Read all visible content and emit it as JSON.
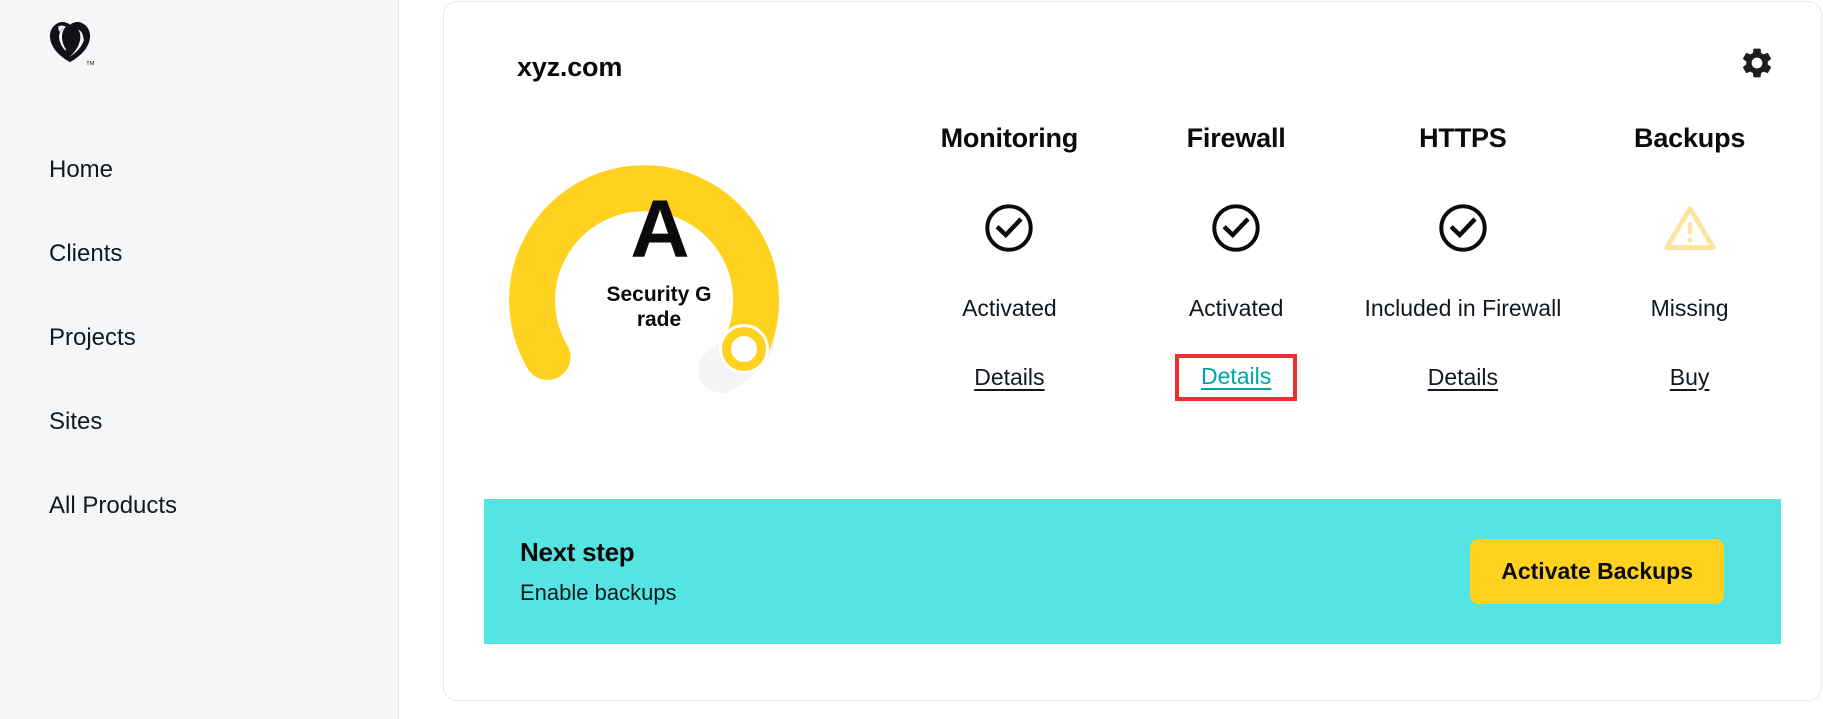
{
  "sidebar": {
    "logo": {
      "name": "godaddy-logo",
      "trademark": "TM"
    },
    "items": [
      {
        "label": "Home"
      },
      {
        "label": "Clients"
      },
      {
        "label": "Projects"
      },
      {
        "label": "Sites"
      },
      {
        "label": "All Products"
      }
    ]
  },
  "card": {
    "site_title": "xyz.com",
    "settings_icon": "gear-icon",
    "gauge": {
      "grade": "A",
      "label": "Security Grade",
      "label_rendered_line1": "Securit",
      "label_rendered_line2": "y Grade",
      "arc_color": "#ffd21f",
      "track_color": "#f2f4f6",
      "marker_color": "#ffd21f",
      "fill_fraction": 0.85
    },
    "columns": [
      {
        "title": "Monitoring",
        "icon": "check-circle-icon",
        "icon_color": "#0b0b0b",
        "status": "Activated",
        "link": "Details",
        "highlighted": false
      },
      {
        "title": "Firewall",
        "icon": "check-circle-icon",
        "icon_color": "#0b0b0b",
        "status": "Activated",
        "link": "Details",
        "highlighted": true,
        "highlight_color": "#ee2e32",
        "link_color": "#01a4a4"
      },
      {
        "title": "HTTPS",
        "icon": "check-circle-icon",
        "icon_color": "#0b0b0b",
        "status": "Included in Firewall",
        "link": "Details",
        "highlighted": false
      },
      {
        "title": "Backups",
        "icon": "warning-triangle-icon",
        "icon_color": "#fbe4a0",
        "status": "Missing",
        "link": "Buy",
        "highlighted": false
      }
    ],
    "banner": {
      "title": "Next step",
      "subtitle": "Enable backups",
      "button_label": "Activate Backups",
      "background": "#54e5e3",
      "button_color": "#ffd21f"
    }
  }
}
